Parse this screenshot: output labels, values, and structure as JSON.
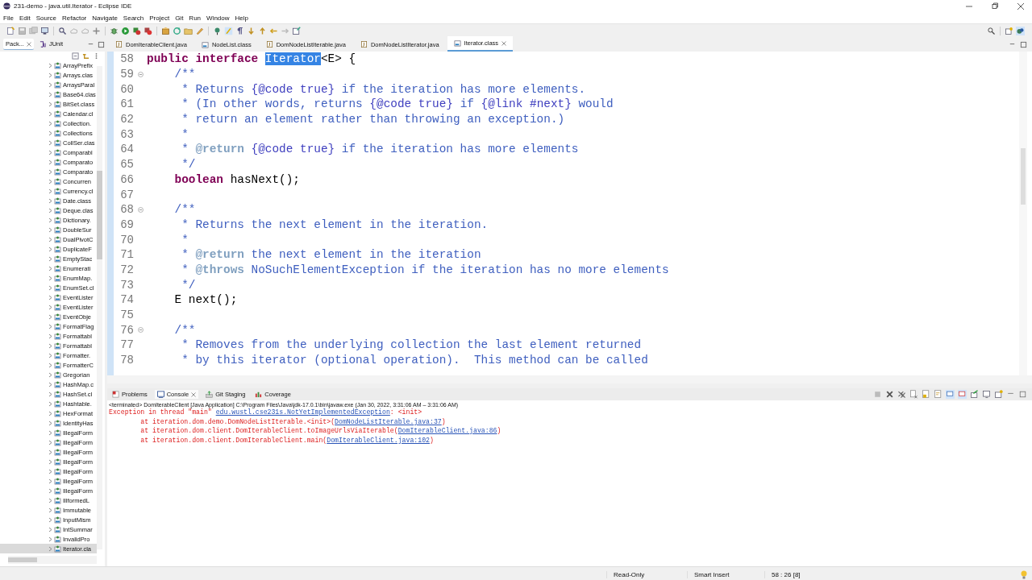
{
  "window": {
    "title": "231-demo - java.util.Iterator - Eclipse IDE"
  },
  "menu": [
    "File",
    "Edit",
    "Source",
    "Refactor",
    "Navigate",
    "Search",
    "Project",
    "Git",
    "Run",
    "Window",
    "Help"
  ],
  "view_tabs": [
    {
      "label": "Pack...",
      "selected": true,
      "closable": true
    },
    {
      "label": "JUnit",
      "selected": false,
      "closable": false
    }
  ],
  "package_tree": {
    "items": [
      {
        "label": "ArrayPrefix",
        "selected": false
      },
      {
        "label": "Arrays.clas",
        "selected": false
      },
      {
        "label": "ArraysParal",
        "selected": false
      },
      {
        "label": "Base64.clas",
        "selected": false
      },
      {
        "label": "BitSet.class",
        "selected": false
      },
      {
        "label": "Calendar.cl",
        "selected": false
      },
      {
        "label": "Collection.",
        "selected": false
      },
      {
        "label": "Collections",
        "selected": false
      },
      {
        "label": "CollSer.clas",
        "selected": false
      },
      {
        "label": "Comparabl",
        "selected": false
      },
      {
        "label": "Comparato",
        "selected": false
      },
      {
        "label": "Comparato",
        "selected": false
      },
      {
        "label": "Concurren",
        "selected": false
      },
      {
        "label": "Currency.cl",
        "selected": false
      },
      {
        "label": "Date.class",
        "selected": false
      },
      {
        "label": "Deque.clas",
        "selected": false
      },
      {
        "label": "Dictionary.",
        "selected": false
      },
      {
        "label": "DoubleSur",
        "selected": false
      },
      {
        "label": "DualPivotC",
        "selected": false
      },
      {
        "label": "DuplicateF",
        "selected": false
      },
      {
        "label": "EmptyStac",
        "selected": false
      },
      {
        "label": "Enumerati",
        "selected": false
      },
      {
        "label": "EnumMap.",
        "selected": false
      },
      {
        "label": "EnumSet.cl",
        "selected": false
      },
      {
        "label": "EventLister",
        "selected": false
      },
      {
        "label": "EventLister",
        "selected": false
      },
      {
        "label": "EventObje",
        "selected": false
      },
      {
        "label": "FormatFlag",
        "selected": false
      },
      {
        "label": "Formattabl",
        "selected": false
      },
      {
        "label": "Formattabl",
        "selected": false
      },
      {
        "label": "Formatter.",
        "selected": false
      },
      {
        "label": "FormatterC",
        "selected": false
      },
      {
        "label": "Gregorian",
        "selected": false
      },
      {
        "label": "HashMap.c",
        "selected": false
      },
      {
        "label": "HashSet.cl",
        "selected": false
      },
      {
        "label": "Hashtable.",
        "selected": false
      },
      {
        "label": "HexFormat",
        "selected": false
      },
      {
        "label": "IdentityHas",
        "selected": false
      },
      {
        "label": "IllegalForm",
        "selected": false
      },
      {
        "label": "IllegalForm",
        "selected": false
      },
      {
        "label": "IllegalForm",
        "selected": false
      },
      {
        "label": "IllegalForm",
        "selected": false
      },
      {
        "label": "IllegalForm",
        "selected": false
      },
      {
        "label": "IllegalForm",
        "selected": false
      },
      {
        "label": "IllegalForm",
        "selected": false
      },
      {
        "label": "IllformedL",
        "selected": false
      },
      {
        "label": "Immutable",
        "selected": false
      },
      {
        "label": "InputMism",
        "selected": false
      },
      {
        "label": "IntSummar",
        "selected": false
      },
      {
        "label": "InvalidPro",
        "selected": false
      },
      {
        "label": "Iterator.cla",
        "selected": true
      }
    ]
  },
  "editor_tabs": [
    {
      "label": "DomIterableClient.java",
      "kind": "java",
      "selected": false
    },
    {
      "label": "NodeList.class",
      "kind": "class",
      "selected": false
    },
    {
      "label": "DomNodeListIterable.java",
      "kind": "java",
      "selected": false
    },
    {
      "label": "DomNodeListIterator.java",
      "kind": "java",
      "selected": false
    },
    {
      "label": "Iterator.class",
      "kind": "class",
      "selected": true
    }
  ],
  "editor": {
    "lines": [
      {
        "number": "58",
        "fold": false,
        "segments": [
          {
            "kind": "keyword",
            "text": "public interface "
          },
          {
            "kind": "selected",
            "text": "Iterator"
          },
          {
            "kind": "plain",
            "text": "<E> {"
          }
        ]
      },
      {
        "number": "59",
        "fold": true,
        "segments": [
          {
            "kind": "javadoc",
            "text": "    /**"
          }
        ]
      },
      {
        "number": "60",
        "fold": false,
        "segments": [
          {
            "kind": "javadoc",
            "text": "     * Returns "
          },
          {
            "kind": "inline",
            "text": "{@code true}"
          },
          {
            "kind": "javadoc",
            "text": " if the iteration has more elements."
          }
        ]
      },
      {
        "number": "61",
        "fold": false,
        "segments": [
          {
            "kind": "javadoc",
            "text": "     * (In other words, returns "
          },
          {
            "kind": "inline",
            "text": "{@code true}"
          },
          {
            "kind": "javadoc",
            "text": " if "
          },
          {
            "kind": "inline",
            "text": "{@link #next}"
          },
          {
            "kind": "javadoc",
            "text": " would"
          }
        ]
      },
      {
        "number": "62",
        "fold": false,
        "segments": [
          {
            "kind": "javadoc",
            "text": "     * return an element rather than throwing an exception.)"
          }
        ]
      },
      {
        "number": "63",
        "fold": false,
        "segments": [
          {
            "kind": "javadoc",
            "text": "     *"
          }
        ]
      },
      {
        "number": "64",
        "fold": false,
        "segments": [
          {
            "kind": "javadoc",
            "text": "     * "
          },
          {
            "kind": "tag",
            "text": "@return"
          },
          {
            "kind": "inline",
            "text": " {@code true}"
          },
          {
            "kind": "javadoc",
            "text": " if the iteration has more elements"
          }
        ]
      },
      {
        "number": "65",
        "fold": false,
        "segments": [
          {
            "kind": "javadoc",
            "text": "     */"
          }
        ]
      },
      {
        "number": "66",
        "fold": false,
        "segments": [
          {
            "kind": "keyword",
            "text": "    boolean"
          },
          {
            "kind": "plain",
            "text": " hasNext();"
          }
        ]
      },
      {
        "number": "67",
        "fold": false
      },
      {
        "number": "68",
        "fold": true,
        "segments": [
          {
            "kind": "javadoc",
            "text": "    /**"
          }
        ]
      },
      {
        "number": "69",
        "fold": false,
        "segments": [
          {
            "kind": "javadoc",
            "text": "     * Returns the next element in the iteration."
          }
        ]
      },
      {
        "number": "70",
        "fold": false,
        "segments": [
          {
            "kind": "javadoc",
            "text": "     *"
          }
        ]
      },
      {
        "number": "71",
        "fold": false,
        "segments": [
          {
            "kind": "javadoc",
            "text": "     * "
          },
          {
            "kind": "tag",
            "text": "@return"
          },
          {
            "kind": "javadoc",
            "text": " the next element in the iteration"
          }
        ]
      },
      {
        "number": "72",
        "fold": false,
        "segments": [
          {
            "kind": "javadoc",
            "text": "     * "
          },
          {
            "kind": "tag",
            "text": "@throws"
          },
          {
            "kind": "javadoc",
            "text": " NoSuchElementException if the iteration has no more elements"
          }
        ]
      },
      {
        "number": "73",
        "fold": false,
        "segments": [
          {
            "kind": "javadoc",
            "text": "     */"
          }
        ]
      },
      {
        "number": "74",
        "fold": false,
        "segments": [
          {
            "kind": "plain",
            "text": "    E next();"
          }
        ]
      },
      {
        "number": "75",
        "fold": false
      },
      {
        "number": "76",
        "fold": true,
        "segments": [
          {
            "kind": "javadoc",
            "text": "    /**"
          }
        ]
      },
      {
        "number": "77",
        "fold": false,
        "segments": [
          {
            "kind": "javadoc",
            "text": "     * Removes from the underlying collection the last element returned"
          }
        ]
      },
      {
        "number": "78",
        "fold": false,
        "segments": [
          {
            "kind": "javadoc",
            "text": "     * by this iterator (optional operation).  This method can be called"
          }
        ]
      }
    ]
  },
  "bottom_tabs": [
    {
      "label": "Problems",
      "selected": false,
      "closable": false
    },
    {
      "label": "Console",
      "selected": true,
      "closable": true
    },
    {
      "label": "Git Staging",
      "selected": false,
      "closable": false
    },
    {
      "label": "Coverage",
      "selected": false,
      "closable": false
    }
  ],
  "console": {
    "status": "<terminated> DomIterableClient [Java Application] C:\\Program Files\\Java\\jdk-17.0.1\\bin\\javaw.exe  (Jan 30, 2022, 3:31:06 AM – 3:31:06 AM)",
    "lines": [
      {
        "segments": [
          {
            "kind": "error",
            "text": "Exception in thread \"main\" "
          },
          {
            "kind": "link",
            "text": "edu.wustl.cse231s.NotYetImplementedException"
          },
          {
            "kind": "error",
            "text": ": <init>"
          }
        ]
      },
      {
        "segments": [
          {
            "kind": "error",
            "text": "        at iteration.dom.demo.DomNodeListIterable.<init>("
          },
          {
            "kind": "link",
            "text": "DomNodeListIterable.java:37"
          },
          {
            "kind": "error",
            "text": ")"
          }
        ]
      },
      {
        "segments": [
          {
            "kind": "error",
            "text": "        at iteration.dom.client.DomIterableClient.toImageUrlsViaIterable("
          },
          {
            "kind": "link",
            "text": "DomIterableClient.java:86"
          },
          {
            "kind": "error",
            "text": ")"
          }
        ]
      },
      {
        "segments": [
          {
            "kind": "error",
            "text": "        at iteration.dom.client.DomIterableClient.main("
          },
          {
            "kind": "link",
            "text": "DomIterableClient.java:102"
          },
          {
            "kind": "error",
            "text": ")"
          }
        ]
      }
    ]
  },
  "status_bar": [
    "Read-Only",
    "Smart Insert",
    "58 : 26 [8]"
  ]
}
